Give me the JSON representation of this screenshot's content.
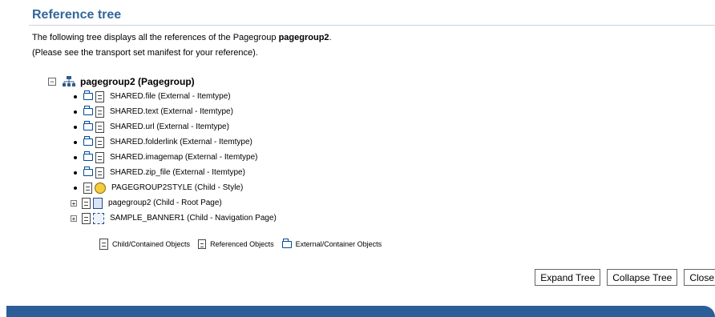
{
  "header": {
    "title": "Reference tree"
  },
  "intro": {
    "line1_prefix": "The following tree displays all the references of the Pagegroup ",
    "pagegroup_name": "pagegroup2",
    "line1_suffix": ".",
    "line2": "(Please see the transport set manifest for your reference)."
  },
  "tree": {
    "root_label": "pagegroup2 (Pagegroup)",
    "items": [
      {
        "label": "SHARED.file (External - Itemtype)",
        "kind": "external"
      },
      {
        "label": "SHARED.text (External - Itemtype)",
        "kind": "external"
      },
      {
        "label": "SHARED.url (External - Itemtype)",
        "kind": "external"
      },
      {
        "label": "SHARED.folderlink (External - Itemtype)",
        "kind": "external"
      },
      {
        "label": "SHARED.imagemap (External - Itemtype)",
        "kind": "external"
      },
      {
        "label": "SHARED.zip_file (External - Itemtype)",
        "kind": "external"
      },
      {
        "label": "PAGEGROUP2STYLE (Child - Style)",
        "kind": "style"
      },
      {
        "label": "pagegroup2 (Child - Root Page)",
        "kind": "rootpage"
      },
      {
        "label": "SAMPLE_BANNER1 (Child - Navigation Page)",
        "kind": "navpage"
      }
    ]
  },
  "legend": {
    "child": "Child/Contained Objects",
    "referenced": "Referenced Objects",
    "external": "External/Container Objects"
  },
  "buttons": {
    "expand": "Expand Tree",
    "collapse": "Collapse Tree",
    "close": "Close"
  },
  "colors": {
    "heading": "#336699",
    "bottom_bar": "#2b5d98"
  },
  "icons": {
    "root": "pagegroup-tree-icon",
    "external": "folder-icon",
    "child": "doc-icon",
    "style": "style-icon",
    "rootpage": "page-icon",
    "navpage": "navigation-page-icon"
  }
}
